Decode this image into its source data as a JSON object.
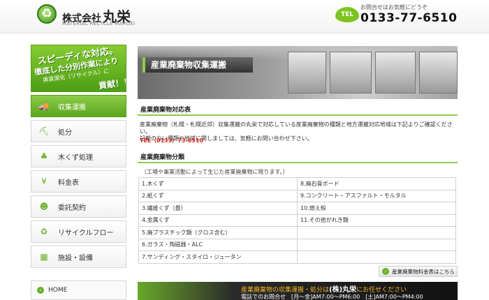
{
  "header": {
    "company_prefix": "株式会社",
    "company_name": "丸栄",
    "company_sub": "MATERIAL RECYCLE MARUEI",
    "tel_badge": "TEL",
    "tel_note": "お問合せはお気軽にどうぞ",
    "tel_number": "0133-77-6510"
  },
  "banner": {
    "line1": "スピーディな対応。",
    "line2": "徹底した分別作業により",
    "line3": "再資源化（リサイクル）に",
    "line4": "貢献！！"
  },
  "nav": [
    {
      "label": "収集運搬",
      "icon": "truck-icon",
      "glyph": "🚚",
      "active": true
    },
    {
      "label": "処分",
      "icon": "excavator-icon",
      "glyph": "⛏",
      "active": false
    },
    {
      "label": "木くず処理",
      "icon": "tree-icon",
      "glyph": "♣",
      "active": false
    },
    {
      "label": "料金表",
      "icon": "yen-icon",
      "glyph": "¥",
      "active": false
    },
    {
      "label": "委託契約",
      "icon": "people-icon",
      "glyph": "☻",
      "active": false
    },
    {
      "label": "リサイクルフロー",
      "icon": "recycle-icon",
      "glyph": "♻",
      "active": false
    },
    {
      "label": "施設・設備",
      "icon": "building-icon",
      "glyph": "▦",
      "active": false
    }
  ],
  "home": {
    "label": "HOME"
  },
  "hero": {
    "title": "産業廃棄物収集運搬"
  },
  "section1": {
    "title": "産業廃棄物対応表",
    "text1": "産業廃棄物（札幌・札幌近郊）収集運搬の丸栄で対応している産業廃棄物の種類と地方運搬対応地域は下記よりご確認ください。",
    "text2": "記載のない種類や地域に関しましては、気軽にお問い合わせ下さい。",
    "tel": "TEL（0133）73-6510"
  },
  "section2": {
    "title": "産業廃棄物分類",
    "note": "（工場や事業活動によって生じた産業廃棄物に限ります。）",
    "rows": [
      [
        "1.木くず",
        "8.廃石膏ボード"
      ],
      [
        "2.紙くず",
        "9.コンクリート・アスファルト・モルタル"
      ],
      [
        "3.繊維くず（畳）",
        "10.燃え殻"
      ],
      [
        "4.金属くず",
        "11.その他がれき類"
      ],
      [
        "5.廃プラスチック類（クロス含む）",
        ""
      ],
      [
        "6.ガラス・陶磁器・ALC",
        ""
      ],
      [
        "7.サンディング・スタイロ・ジュータン",
        ""
      ]
    ]
  },
  "price_link": {
    "label": "産業廃棄物料金表はこちら"
  },
  "footer_banner": {
    "line1_a": "産業廃棄物の収集運搬・処分は",
    "line1_co": "(株)丸栄",
    "line1_b": "にお任せください",
    "line2": "電話でのお問合せ　[月～金]AM7:00～PM6:00　[土]AM7:00～PM4:00"
  },
  "colors": {
    "accent": "#8ccc47",
    "tel_red": "#d12a1a",
    "badge": "#7cc520"
  }
}
